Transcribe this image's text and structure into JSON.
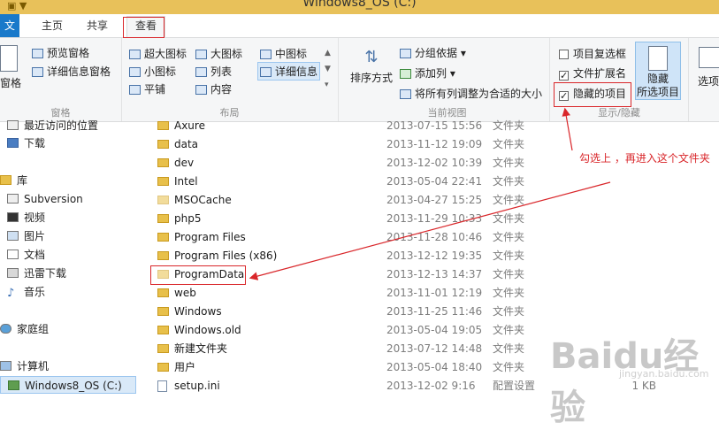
{
  "window": {
    "title": "Windows8_OS (C:)"
  },
  "tabs": [
    {
      "label": "文件"
    },
    {
      "label": "主页"
    },
    {
      "label": "共享"
    },
    {
      "label": "查看"
    }
  ],
  "ribbon": {
    "panes": {
      "label": "窗格",
      "nav_pane": "导航窗格",
      "preview": "预览窗格",
      "details": "详细信息窗格"
    },
    "layout": {
      "label": "布局",
      "extra_large": "超大图标",
      "large": "大图标",
      "medium": "中图标",
      "small": "小图标",
      "list": "列表",
      "details": "详细信息",
      "tiles": "平铺",
      "content": "内容"
    },
    "current_view": {
      "label": "当前视图",
      "sort": "排序方式",
      "group_by": "分组依据",
      "add_col": "添加列",
      "fit_cols": "将所有列调整为合适的大小"
    },
    "show_hide": {
      "label": "显示/隐藏",
      "item_checkboxes": "项目复选框",
      "item_checkboxes_checked": false,
      "file_ext": "文件扩展名",
      "file_ext_checked": true,
      "hidden_items": "隐藏的项目",
      "hidden_items_checked": true,
      "hide_selected_line1": "隐藏",
      "hide_selected_line2": "所选项目"
    },
    "options": "选项"
  },
  "sidebar": {
    "items": [
      {
        "label": "最近访问的位置"
      },
      {
        "label": "下载"
      },
      {
        "label": "库"
      },
      {
        "label": "Subversion"
      },
      {
        "label": "视频"
      },
      {
        "label": "图片"
      },
      {
        "label": "文档"
      },
      {
        "label": "迅雷下载"
      },
      {
        "label": "音乐"
      },
      {
        "label": "家庭组"
      },
      {
        "label": "计算机"
      },
      {
        "label": "Windows8_OS (C:)"
      }
    ]
  },
  "files": [
    {
      "name": "Axure",
      "date": "2013-07-15 15:56",
      "type": "文件夹",
      "size": ""
    },
    {
      "name": "data",
      "date": "2013-11-12 19:09",
      "type": "文件夹",
      "size": ""
    },
    {
      "name": "dev",
      "date": "2013-12-02 10:39",
      "type": "文件夹",
      "size": ""
    },
    {
      "name": "Intel",
      "date": "2013-05-04 22:41",
      "type": "文件夹",
      "size": ""
    },
    {
      "name": "MSOCache",
      "date": "2013-04-27 15:25",
      "type": "文件夹",
      "size": ""
    },
    {
      "name": "php5",
      "date": "2013-11-29 10:33",
      "type": "文件夹",
      "size": ""
    },
    {
      "name": "Program Files",
      "date": "2013-11-28 10:46",
      "type": "文件夹",
      "size": ""
    },
    {
      "name": "Program Files (x86)",
      "date": "2013-12-12 19:35",
      "type": "文件夹",
      "size": ""
    },
    {
      "name": "ProgramData",
      "date": "2013-12-13 14:37",
      "type": "文件夹",
      "size": ""
    },
    {
      "name": "web",
      "date": "2013-11-01 12:19",
      "type": "文件夹",
      "size": ""
    },
    {
      "name": "Windows",
      "date": "2013-11-25 11:46",
      "type": "文件夹",
      "size": ""
    },
    {
      "name": "Windows.old",
      "date": "2013-05-04 19:05",
      "type": "文件夹",
      "size": ""
    },
    {
      "name": "新建文件夹",
      "date": "2013-07-12 14:48",
      "type": "文件夹",
      "size": ""
    },
    {
      "name": "用户",
      "date": "2013-05-04 18:40",
      "type": "文件夹",
      "size": ""
    },
    {
      "name": "setup.ini",
      "date": "2013-12-02 9:16",
      "type": "配置设置",
      "size": "1 KB"
    }
  ],
  "annotation": {
    "text": "勾选上 ，再进入这个文件夹",
    "color": "#d9262a"
  },
  "watermark": {
    "text": "Baidu经验",
    "sub": "jingyan.baidu.com"
  },
  "colors": {
    "accent": "#1979ca",
    "highlight": "#d9262a",
    "folder": "#e8c04a"
  }
}
